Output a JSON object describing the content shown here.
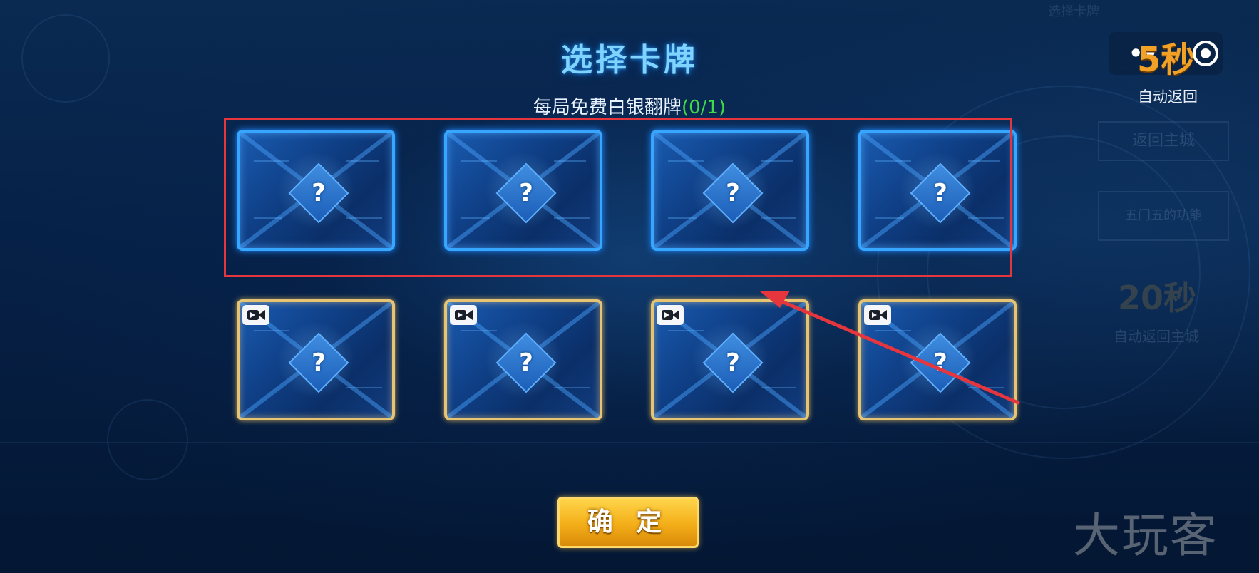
{
  "header": {
    "title": "选择卡牌",
    "subtitle_text": "每局免费白银翻牌",
    "subtitle_count": "(0/1)"
  },
  "timer": {
    "dots": "••",
    "value": "5秒",
    "label": "自动返回"
  },
  "background_panel": {
    "top_text": "选择卡牌",
    "button1": "返回主城",
    "button2": "五门五的功能",
    "timer": "20秒",
    "timer_label": "自动返回主城"
  },
  "cards": {
    "free_row": [
      {
        "symbol": "?"
      },
      {
        "symbol": "?"
      },
      {
        "symbol": "?"
      },
      {
        "symbol": "?"
      }
    ],
    "video_row": [
      {
        "symbol": "?"
      },
      {
        "symbol": "?"
      },
      {
        "symbol": "?"
      },
      {
        "symbol": "?"
      }
    ]
  },
  "actions": {
    "confirm": "确 定"
  },
  "watermark": "大玩客",
  "colors": {
    "title": "#7fd4ff",
    "count": "#3ddb46",
    "timer": "#f1a126",
    "annotation": "#e5353d",
    "silver_border": "#36a6ff",
    "gold_border": "#e6c471",
    "confirm": "#f3ae18"
  },
  "icons": [
    "question-icon",
    "video-icon",
    "record-icon"
  ]
}
